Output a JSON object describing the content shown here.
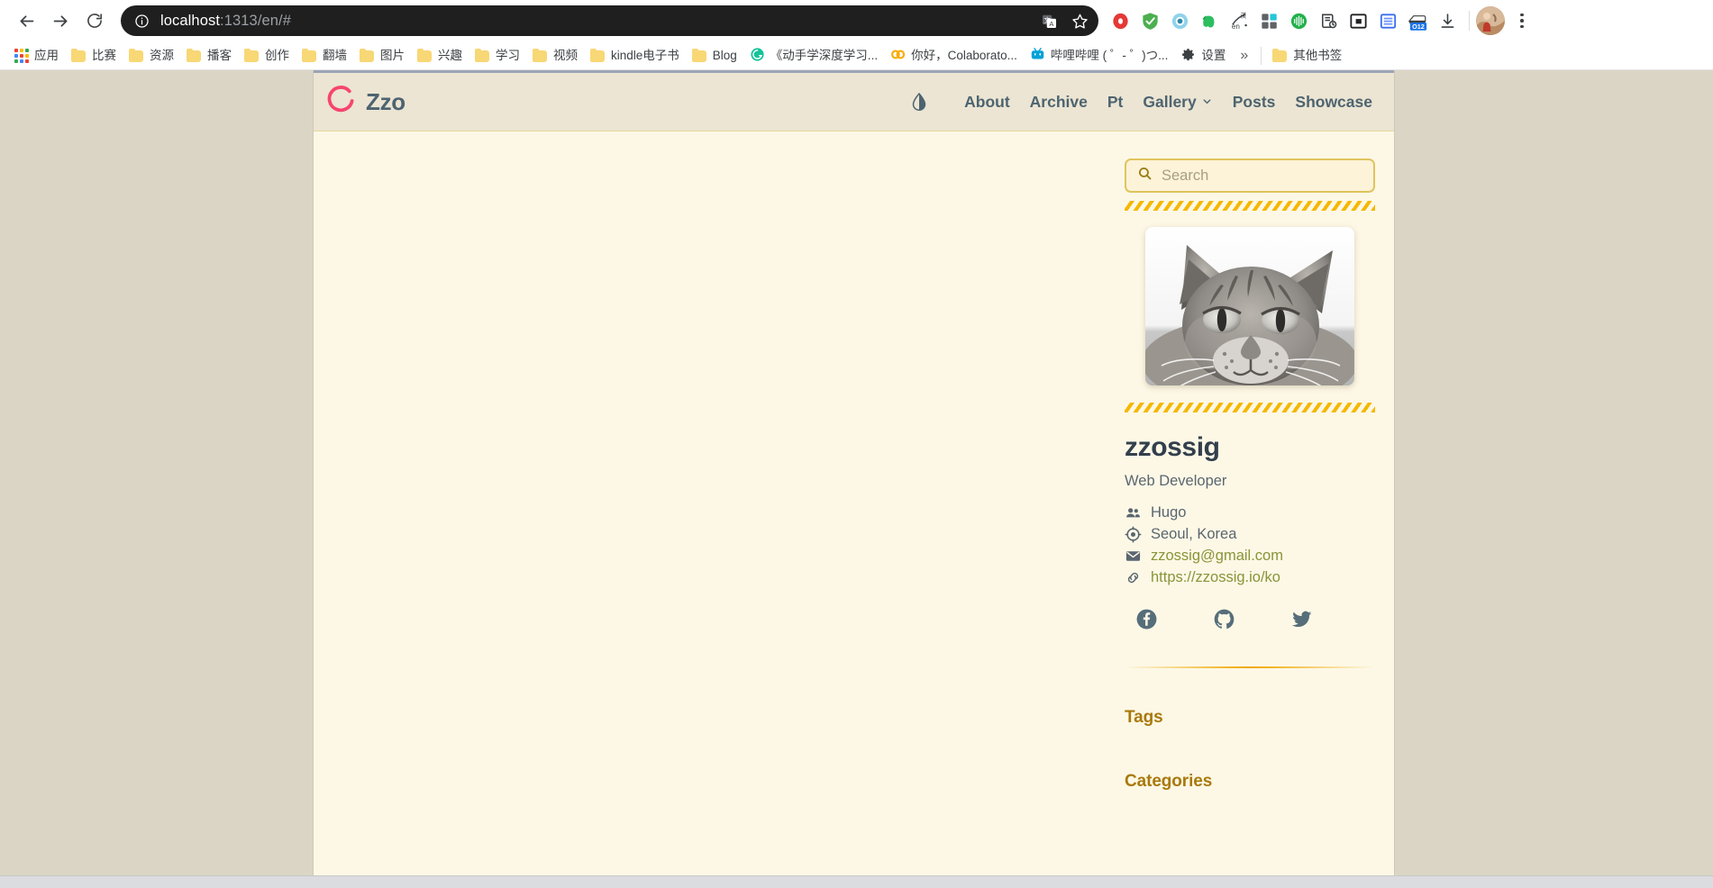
{
  "browser": {
    "back_label": "Back",
    "forward_label": "Forward",
    "reload_label": "Reload",
    "site_info_icon": "info-circle-icon",
    "url_host": "localhost",
    "url_rest": ":1313/en/#",
    "url_full": "localhost:1313/en/#",
    "omnibox_icons": [
      {
        "name": "translate-icon",
        "label": "Translate this page"
      },
      {
        "name": "bookmark-star-icon",
        "label": "Bookmark this tab"
      }
    ],
    "extensions": [
      {
        "name": "recorder-extension-icon",
        "color": "#e53935"
      },
      {
        "name": "shield-check-extension-icon",
        "color": "#43a047"
      },
      {
        "name": "eye-extension-icon",
        "color": "#81cfe8"
      },
      {
        "name": "evernote-extension-icon",
        "color": "#2dbe60"
      },
      {
        "name": "translator-en-extension-icon",
        "color": "#3c4043"
      },
      {
        "name": "squares-extension-icon",
        "color": "#5f6368"
      },
      {
        "name": "audio-wave-extension-icon",
        "color": "#22b14c"
      },
      {
        "name": "reading-list-extension-icon",
        "color": "#3c4043"
      },
      {
        "name": "picture-in-picture-icon",
        "color": "#202124"
      },
      {
        "name": "sidebar-extension-icon",
        "color": "#3b6ef0"
      },
      {
        "name": "012-badge-extension-icon",
        "color": "#1a73e8",
        "badge": "O12"
      },
      {
        "name": "downloads-icon",
        "color": "#3c4043"
      }
    ],
    "profile_label": "Profile",
    "menu_label": "Customize and control Google Chrome",
    "bookmarks": [
      {
        "label": "应用",
        "icon": "apps-grid-icon"
      },
      {
        "label": "比赛",
        "icon": "folder-icon"
      },
      {
        "label": "资源",
        "icon": "folder-icon"
      },
      {
        "label": "播客",
        "icon": "folder-icon"
      },
      {
        "label": "创作",
        "icon": "folder-icon"
      },
      {
        "label": "翻墙",
        "icon": "folder-icon"
      },
      {
        "label": "图片",
        "icon": "folder-icon"
      },
      {
        "label": "兴趣",
        "icon": "folder-icon"
      },
      {
        "label": "学习",
        "icon": "folder-icon"
      },
      {
        "label": "视频",
        "icon": "folder-icon"
      },
      {
        "label": "kindle电子书",
        "icon": "folder-icon"
      },
      {
        "label": "Blog",
        "icon": "folder-icon"
      },
      {
        "label": "《动手学深度学习...",
        "icon": "grammarly-icon"
      },
      {
        "label": "你好，Colaborato...",
        "icon": "colab-icon"
      },
      {
        "label": "哔哩哔哩 ( ゜- ゜)つ...",
        "icon": "bilibili-icon"
      },
      {
        "label": "设置",
        "icon": "gear-icon"
      }
    ],
    "bookmarks_overflow_label": "»",
    "other_bookmarks": {
      "label": "其他书签",
      "icon": "folder-icon"
    }
  },
  "site": {
    "brand": {
      "name": "Zzo",
      "logo_icon": "zzo-circle-brush-logo",
      "logo_color": "#f6456f",
      "text_color": "#4d6470"
    },
    "theme_toggle": {
      "name": "theme-toggle-droplet-icon",
      "label": "Toggle theme"
    },
    "nav": [
      {
        "label": "About",
        "has_dropdown": false
      },
      {
        "label": "Archive",
        "has_dropdown": false
      },
      {
        "label": "Pt",
        "has_dropdown": false
      },
      {
        "label": "Gallery",
        "has_dropdown": true
      },
      {
        "label": "Posts",
        "has_dropdown": false
      },
      {
        "label": "Showcase",
        "has_dropdown": false
      }
    ]
  },
  "sidebar": {
    "search": {
      "placeholder": "Search",
      "value": "",
      "icon": "search-magnifier-icon"
    },
    "avatar": {
      "alt": "Grayscale photo of a tabby cat resting"
    },
    "profile": {
      "name": "zzossig",
      "role": "Web Developer"
    },
    "info": [
      {
        "icon": "people-icon",
        "text": "Hugo",
        "is_link": false
      },
      {
        "icon": "location-icon",
        "text": "Seoul, Korea",
        "is_link": false
      },
      {
        "icon": "envelope-icon",
        "text": "zzossig@gmail.com",
        "is_link": true
      },
      {
        "icon": "link-icon",
        "text": "https://zzossig.io/ko",
        "is_link": true
      }
    ],
    "social": [
      {
        "name": "facebook-icon",
        "label": "Facebook"
      },
      {
        "name": "github-icon",
        "label": "GitHub"
      },
      {
        "name": "twitter-icon",
        "label": "Twitter"
      }
    ],
    "sections": [
      {
        "heading": "Tags"
      },
      {
        "heading": "Categories"
      }
    ]
  },
  "colors": {
    "page_outer_bg": "#dbd5c5",
    "content_bg": "#fdf8e6",
    "header_bg": "#ece5d3",
    "accent_gold": "#f5b800",
    "heading_gold": "#a9790a",
    "nav_text": "#4d6470",
    "link_olive": "#8a9438",
    "brand_pink": "#f6456f"
  }
}
